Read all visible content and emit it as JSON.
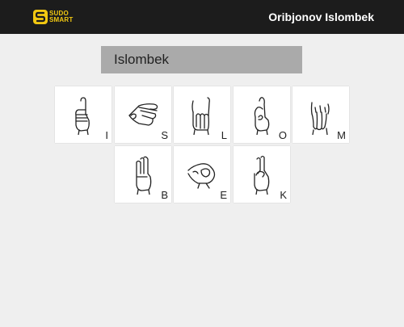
{
  "header": {
    "logo": {
      "line1": "SUDO",
      "line2": "SMART",
      "color": "#f2c811"
    },
    "user_name": "Oribjonov Islombek"
  },
  "word": "Islombek",
  "cards": [
    {
      "letter": "I",
      "icon": "sign-i-hand-icon"
    },
    {
      "letter": "S",
      "icon": "sign-s-hand-icon"
    },
    {
      "letter": "L",
      "icon": "sign-l-hand-icon"
    },
    {
      "letter": "O",
      "icon": "sign-o-hand-icon"
    },
    {
      "letter": "M",
      "icon": "sign-m-hand-icon"
    },
    {
      "letter": "B",
      "icon": "sign-b-hand-icon"
    },
    {
      "letter": "E",
      "icon": "sign-e-hand-icon"
    },
    {
      "letter": "K",
      "icon": "sign-k-hand-icon"
    }
  ]
}
